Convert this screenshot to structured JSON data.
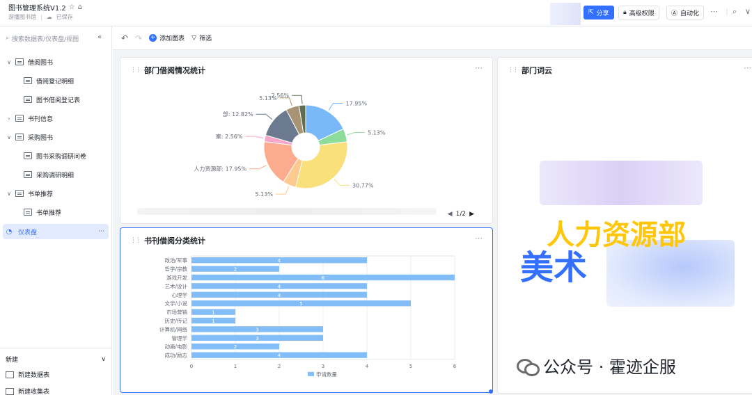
{
  "header": {
    "title": "图书管理系统V1.2",
    "subtitle": "游播图书馆",
    "saved_status": "已保存",
    "share_label": "分享",
    "permission_label": "高级权限",
    "automation_label": "自动化"
  },
  "sidebar": {
    "search_placeholder": "搜索数据表/仪表盘/视图",
    "items": [
      {
        "label": "借阅图书",
        "level": 0,
        "expanded": true
      },
      {
        "label": "借阅登记明细",
        "level": 1
      },
      {
        "label": "图书借阅登记表",
        "level": 1
      },
      {
        "label": "书刊信息",
        "level": 0,
        "expanded": false
      },
      {
        "label": "采购图书",
        "level": 0,
        "expanded": true
      },
      {
        "label": "图书采购调研问卷",
        "level": 1
      },
      {
        "label": "采购调研明细",
        "level": 1
      },
      {
        "label": "书单推荐",
        "level": 0,
        "expanded": true
      },
      {
        "label": "书单推荐",
        "level": 1
      },
      {
        "label": "仪表盘",
        "level": 0,
        "active": true
      }
    ],
    "new_section": "新建",
    "new_table": "新建数据表",
    "new_form": "新建收集表"
  },
  "toolbar": {
    "add_chart_label": "添加图表",
    "filter_label": "筛选"
  },
  "pie_card": {
    "title": "部门借阅情况统计",
    "pager": "1/2"
  },
  "wordcloud_card": {
    "title": "部门词云",
    "words": [
      "人力资源部",
      "美术"
    ]
  },
  "bar_card": {
    "title": "书刊借阅分类统计"
  },
  "watermark": {
    "text": "公众号 · 霍迹企服"
  },
  "chart_data": [
    {
      "type": "pie",
      "title": "部门借阅情况统计",
      "slices": [
        {
          "label": "",
          "value": 17.95,
          "value_label": "17.95%",
          "color": "#7ab9f9"
        },
        {
          "label": "",
          "value": 5.13,
          "value_label": "5.13%",
          "color": "#8edc9b"
        },
        {
          "label": "",
          "value": 30.77,
          "value_label": "30.77%",
          "color": "#f9e07a"
        },
        {
          "label": "",
          "value": 5.13,
          "value_label": "5.13%",
          "color": "#fcc98e"
        },
        {
          "label": "人力资源部",
          "value": 17.95,
          "value_label": "17.95%",
          "color": "#fdab8f"
        },
        {
          "label": "案",
          "value": 2.56,
          "value_label": "2.56%",
          "color": "#f6a6c9"
        },
        {
          "label": "部",
          "value": 12.82,
          "value_label": "12.82%",
          "color": "#6b7a8f"
        },
        {
          "label": "",
          "value": 5.13,
          "value_label": "5.13%",
          "color": "#a89474"
        },
        {
          "label": "",
          "value": 2.56,
          "value_label": "2.56%",
          "color": "#5d6d4e"
        }
      ]
    },
    {
      "type": "bar",
      "orientation": "horizontal",
      "title": "书刊借阅分类统计",
      "categories": [
        "政治/军事",
        "哲学/宗教",
        "游戏开发",
        "艺术/设计",
        "心理学",
        "文学/小说",
        "市场营销",
        "历史/传记",
        "计算机/网络",
        "管理学",
        "动画/电影",
        "成功/励志"
      ],
      "series": [
        {
          "name": "申请数量",
          "values": [
            4,
            2,
            6,
            4,
            4,
            5,
            1,
            1,
            3,
            3,
            2,
            4
          ],
          "color": "#82bdf7"
        }
      ],
      "xlim": [
        0,
        6
      ],
      "xticks": [
        0,
        1,
        2,
        3,
        4,
        5,
        6
      ],
      "grid": true,
      "legend": "bottom"
    }
  ]
}
